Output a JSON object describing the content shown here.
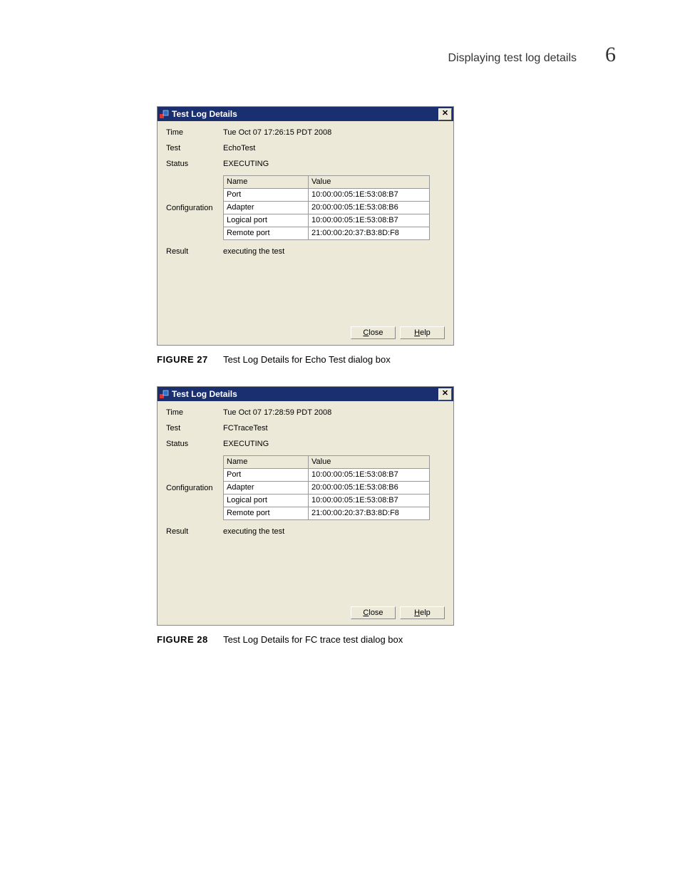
{
  "header": {
    "text": "Displaying test log details",
    "chapter": "6"
  },
  "dialogs": [
    {
      "title": "Test Log Details",
      "rows": {
        "time_label": "Time",
        "time_value": "Tue Oct 07 17:26:15 PDT 2008",
        "test_label": "Test",
        "test_value": "EchoTest",
        "status_label": "Status",
        "status_value": "EXECUTING",
        "config_label": "Configuration",
        "result_label": "Result",
        "result_value": "executing the test"
      },
      "config": {
        "headers": [
          "Name",
          "Value"
        ],
        "rows": [
          [
            "Port",
            "10:00:00:05:1E:53:08:B7"
          ],
          [
            "Adapter",
            "20:00:00:05:1E:53:08:B6"
          ],
          [
            "Logical port",
            "10:00:00:05:1E:53:08:B7"
          ],
          [
            "Remote port",
            "21:00:00:20:37:B3:8D:F8"
          ]
        ]
      },
      "buttons": {
        "close": "Close",
        "help": "Help"
      },
      "caption": {
        "fig": "FIGURE 27",
        "text": "Test Log Details for Echo Test dialog box"
      }
    },
    {
      "title": "Test Log Details",
      "rows": {
        "time_label": "Time",
        "time_value": "Tue Oct 07 17:28:59 PDT 2008",
        "test_label": "Test",
        "test_value": "FCTraceTest",
        "status_label": "Status",
        "status_value": "EXECUTING",
        "config_label": "Configuration",
        "result_label": "Result",
        "result_value": "executing the test"
      },
      "config": {
        "headers": [
          "Name",
          "Value"
        ],
        "rows": [
          [
            "Port",
            "10:00:00:05:1E:53:08:B7"
          ],
          [
            "Adapter",
            "20:00:00:05:1E:53:08:B6"
          ],
          [
            "Logical port",
            "10:00:00:05:1E:53:08:B7"
          ],
          [
            "Remote port",
            "21:00:00:20:37:B3:8D:F8"
          ]
        ]
      },
      "buttons": {
        "close": "Close",
        "help": "Help"
      },
      "caption": {
        "fig": "FIGURE 28",
        "text": "Test Log Details for FC trace test dialog box"
      }
    }
  ]
}
